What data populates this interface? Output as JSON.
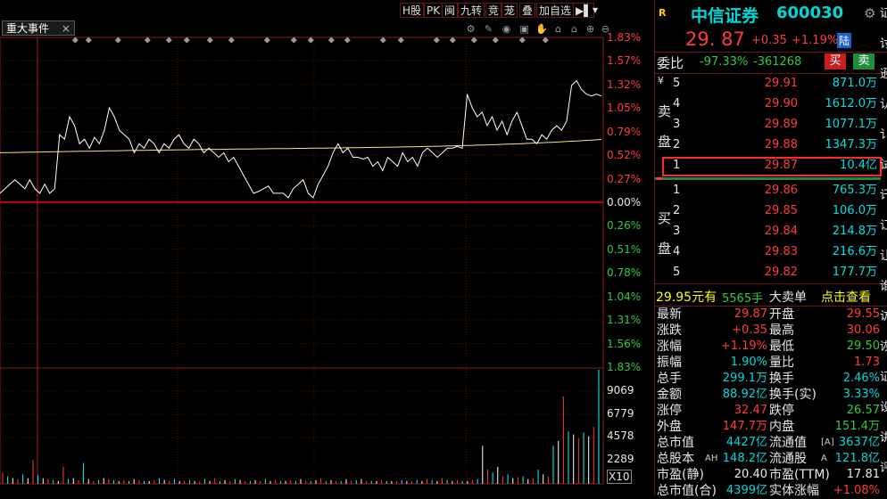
{
  "toolbar": {
    "buttons": [
      "H股",
      "PK",
      "闽",
      "九转",
      "竞",
      "茏",
      "叠",
      "加自选"
    ],
    "menu_icon": "▶▌",
    "dropdown_icon": "▾"
  },
  "event_tab": {
    "label": "重大事件",
    "close": "×"
  },
  "tool_icons": [
    "settings-icon",
    "pen-icon",
    "eye-icon",
    "basket-icon",
    "hand-icon",
    "lock-icon",
    "lock-alt-icon",
    "zoom-in-icon",
    "zoom-out-icon"
  ],
  "price_axis": {
    "up": [
      "1.83%",
      "1.57%",
      "1.32%",
      "1.05%",
      "0.79%",
      "0.52%",
      "0.27%"
    ],
    "zero": "0.00%",
    "down": [
      "0.26%",
      "0.51%",
      "0.78%",
      "1.04%",
      "1.31%",
      "1.56%",
      "1.83%"
    ]
  },
  "volume_axis": [
    "9069",
    "6779",
    "4578",
    "2289"
  ],
  "volume_unit": "X10",
  "chart_data": {
    "type": "line",
    "price_series": [
      0.1,
      0.15,
      0.2,
      0.25,
      0.2,
      0.15,
      0.25,
      0.15,
      0.1,
      0.2,
      0.1,
      0.15,
      0.75,
      0.7,
      0.95,
      0.85,
      0.65,
      0.7,
      0.6,
      0.72,
      0.65,
      0.8,
      1.05,
      0.95,
      0.8,
      0.75,
      0.7,
      0.55,
      0.65,
      0.6,
      0.7,
      0.65,
      0.55,
      0.65,
      0.6,
      0.7,
      0.75,
      0.65,
      0.6,
      0.7,
      0.65,
      0.55,
      0.6,
      0.55,
      0.5,
      0.55,
      0.45,
      0.5,
      0.4,
      0.3,
      0.2,
      0.1,
      0.12,
      0.15,
      0.18,
      0.1,
      0.1,
      0.1,
      0.05,
      0.15,
      0.2,
      0.25,
      0.1,
      0.05,
      0.2,
      0.3,
      0.4,
      0.55,
      0.65,
      0.55,
      0.6,
      0.5,
      0.5,
      0.48,
      0.5,
      0.4,
      0.45,
      0.35,
      0.5,
      0.45,
      0.4,
      0.55,
      0.45,
      0.5,
      0.4,
      0.55,
      0.6,
      0.55,
      0.5,
      0.55,
      0.6,
      0.6,
      0.62,
      0.6,
      1.2,
      1.05,
      0.95,
      1.0,
      0.85,
      0.95,
      0.8,
      0.9,
      0.75,
      0.9,
      1.0,
      0.85,
      0.7,
      0.7,
      0.65,
      0.75,
      0.7,
      0.8,
      0.85,
      0.8,
      0.9,
      1.3,
      1.35,
      1.25,
      1.2,
      1.18,
      1.2,
      1.18
    ],
    "avg_series_start": 0.55,
    "avg_series_end": 0.72,
    "volume_series": [
      12,
      8,
      6,
      5,
      10,
      6,
      25,
      9,
      6,
      5,
      4,
      3,
      18,
      5,
      6,
      4,
      22,
      5,
      3,
      4,
      6,
      5,
      4,
      3,
      4,
      3,
      5,
      4,
      3,
      3,
      4,
      6,
      4,
      3,
      5,
      3,
      3,
      4,
      3,
      3,
      5,
      3,
      6,
      3,
      4,
      3,
      5,
      4,
      3,
      3,
      4,
      3,
      5,
      3,
      4,
      3,
      3,
      4,
      3,
      5,
      3,
      3,
      4,
      6,
      3,
      4,
      3,
      3,
      5,
      3,
      4,
      5,
      3,
      3,
      3,
      4,
      3,
      3,
      3,
      4,
      3,
      3,
      4,
      3,
      5,
      4,
      3,
      6,
      4,
      3,
      4,
      3,
      3,
      4,
      5,
      40,
      15,
      12,
      18,
      8,
      10,
      6,
      7,
      8,
      5,
      6,
      15,
      10,
      8,
      40,
      45,
      92,
      55,
      52,
      48,
      54,
      50,
      60,
      120
    ],
    "price_axis_range": [
      -1.83,
      1.83
    ],
    "volume_axis_max": 11400
  },
  "quote": {
    "badge": "R",
    "name": "中信证券",
    "code": "600030",
    "settings_icon": "gear-icon",
    "price": "29. 87",
    "change": "+0.35",
    "change_pct": "+1.19%",
    "flag": "陆",
    "weibi_label": "委比",
    "weibi_pct": "-97.33%",
    "weibi_diff": "-361268",
    "buy_btn": "买",
    "sell_btn": "卖",
    "sell_side_label": [
      "¥",
      "卖",
      "盘"
    ],
    "buy_side_label": [
      "买",
      "盘"
    ],
    "asks": [
      {
        "lvl": "5",
        "price": "29.91",
        "vol": "871.0万"
      },
      {
        "lvl": "4",
        "price": "29.90",
        "vol": "1612.0万"
      },
      {
        "lvl": "3",
        "price": "29.89",
        "vol": "1077.1万"
      },
      {
        "lvl": "2",
        "price": "29.88",
        "vol": "1347.3万"
      },
      {
        "lvl": "1",
        "price": "29.87",
        "vol": "10.4亿"
      }
    ],
    "bids": [
      {
        "lvl": "1",
        "price": "29.86",
        "vol": "765.3万"
      },
      {
        "lvl": "2",
        "price": "29.85",
        "vol": "106.0万"
      },
      {
        "lvl": "3",
        "price": "29.84",
        "vol": "214.8万"
      },
      {
        "lvl": "4",
        "price": "29.83",
        "vol": "216.6万"
      },
      {
        "lvl": "5",
        "price": "29.82",
        "vol": "177.7万"
      }
    ],
    "bigorder": {
      "amount": "29.95元有",
      "hands": "5565手",
      "type": "大卖单",
      "link": "点击查看"
    },
    "stats": [
      {
        "k1": "最新",
        "v1": "29.87",
        "c1": "red",
        "k2": "开盘",
        "v2": "29.55",
        "c2": "red"
      },
      {
        "k1": "涨跌",
        "v1": "+0.35",
        "c1": "red",
        "k2": "最高",
        "v2": "30.06",
        "c2": "red"
      },
      {
        "k1": "涨幅",
        "v1": "+1.19%",
        "c1": "red",
        "k2": "最低",
        "v2": "29.50",
        "c2": "green"
      },
      {
        "k1": "振幅",
        "v1": "1.90%",
        "c1": "cyan",
        "k2": "量比",
        "v2": "1.73",
        "c2": "red"
      },
      {
        "k1": "总手",
        "v1": "299.1万",
        "c1": "cyan",
        "k2": "换手",
        "v2": "2.46%",
        "c2": "cyan"
      },
      {
        "k1": "金额",
        "v1": "88.92亿",
        "c1": "cyan",
        "k2": "换手(实)",
        "v2": "3.33%",
        "c2": "cyan"
      },
      {
        "k1": "涨停",
        "v1": "32.47",
        "c1": "red",
        "k2": "跌停",
        "v2": "26.57",
        "c2": "green"
      },
      {
        "k1": "外盘",
        "v1": "147.7万",
        "c1": "red",
        "k2": "内盘",
        "v2": "151.4万",
        "c2": "green"
      },
      {
        "k1": "总市值",
        "v1": "4427亿",
        "c1": "cyan",
        "k2": "流通值",
        "v2": "3637亿",
        "c2": "cyan",
        "tag2": "[A]"
      },
      {
        "k1": "总股本",
        "v1": "148.2亿",
        "c1": "cyan",
        "k2": "流通股",
        "v2": "121.8亿",
        "c2": "cyan",
        "tag1": "AH",
        "tag2": "A"
      },
      {
        "k1": "市盈(静)",
        "v1": "20.40",
        "c1": "white",
        "k2": "市盈(TTM)",
        "v2": "17.81",
        "c2": "white"
      },
      {
        "k1": "总市值(合)",
        "v1": "4399亿",
        "c1": "cyan",
        "k2": "实体涨幅",
        "v2": "+1.08%",
        "c2": "red"
      }
    ],
    "edge_glyphs": [
      "证",
      "讨",
      "逊",
      "认",
      "讠",
      "试",
      "讦",
      "讧",
      "让",
      "谁",
      "访",
      "诙",
      "证",
      "设",
      "讲",
      "评"
    ]
  }
}
